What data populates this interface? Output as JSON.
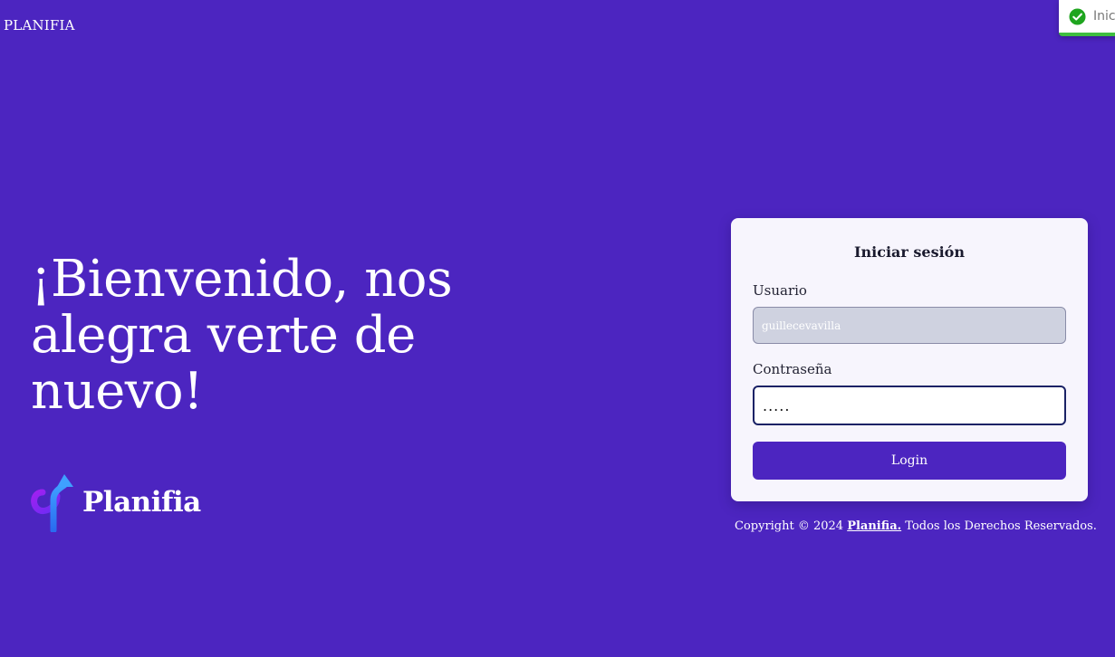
{
  "header": {
    "brand": "PLANIFIA"
  },
  "toast": {
    "text": "Inici",
    "icon": "check-circle-icon",
    "status_color": "#3fbf3f"
  },
  "hero": {
    "headline": "¡Bienvenido, nos alegra verte de nuevo!",
    "logo_text": "Planifia",
    "logo_icon": "planifia-logo-icon"
  },
  "login": {
    "title": "Iniciar sesión",
    "username_label": "Usuario",
    "username_value": "guillecevavilla",
    "password_label": "Contraseña",
    "password_value": ".....",
    "button_label": "Login"
  },
  "footer": {
    "prefix": "Copyright © 2024 ",
    "link": "Planifia.",
    "suffix": " Todos los Derechos Reservados."
  },
  "colors": {
    "background": "#4c25c0",
    "card": "#f7f5fd",
    "button": "#4c25c0",
    "toast_accent": "#3fbf3f"
  }
}
